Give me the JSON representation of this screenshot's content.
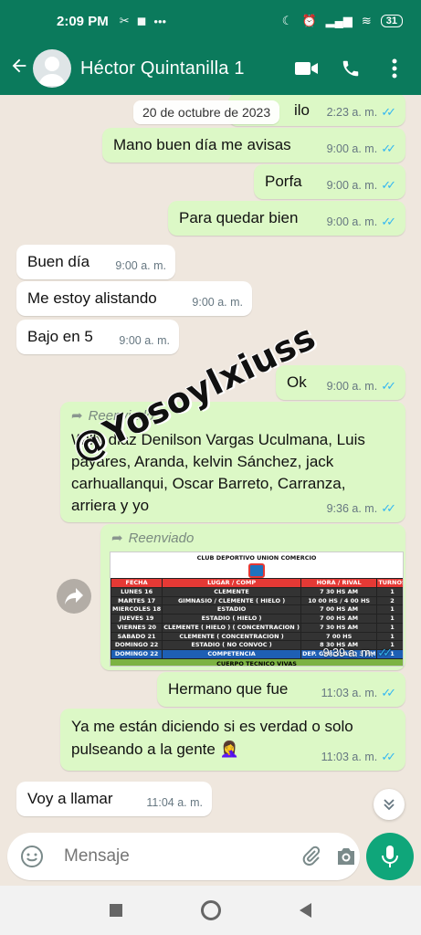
{
  "status_bar": {
    "time": "2:09 PM",
    "battery": "31"
  },
  "header": {
    "contact_name": "Héctor Quintanilla 1"
  },
  "date_chip": "20 de octubre de 2023",
  "messages": [
    {
      "id": "m0",
      "dir": "out",
      "text": "ilo",
      "time": "2:23 a. m."
    },
    {
      "id": "m1",
      "dir": "out",
      "text": "Mano buen día me avisas",
      "time": "9:00 a. m."
    },
    {
      "id": "m2",
      "dir": "out",
      "text": "Porfa",
      "time": "9:00 a. m."
    },
    {
      "id": "m3",
      "dir": "out",
      "text": "Para quedar bien",
      "time": "9:00 a. m."
    },
    {
      "id": "m4",
      "dir": "in",
      "text": "Buen día",
      "time": "9:00 a. m."
    },
    {
      "id": "m5",
      "dir": "in",
      "text": "Me estoy alistando",
      "time": "9:00 a. m."
    },
    {
      "id": "m6",
      "dir": "in",
      "text": "Bajo en 5",
      "time": "9:00 a. m."
    },
    {
      "id": "m7",
      "dir": "out",
      "text": "Ok",
      "time": "9:00 a. m."
    },
    {
      "id": "m8",
      "dir": "out",
      "forwarded": "Reenviado",
      "text": "Willy diaz Denilson Vargas Uculmana, Luis payares, Aranda, kelvin Sánchez, jack carhuallanqui, Oscar Barreto, Carranza, arriera y yo",
      "time": "9:36 a. m."
    },
    {
      "id": "m9",
      "dir": "out",
      "forwarded": "Reenviado",
      "time": "9:39 a. m."
    },
    {
      "id": "m10",
      "dir": "out",
      "text": "Hermano que fue",
      "time": "11:03 a. m."
    },
    {
      "id": "m11",
      "dir": "out",
      "text": "Ya me están diciendo si es verdad o solo pulseando a la gente 🤦‍♀️",
      "time": "11:03 a. m."
    },
    {
      "id": "m12",
      "dir": "in",
      "text": "Voy a llamar",
      "time": "11:04 a. m."
    }
  ],
  "schedule_image": {
    "title": "CLUB DEPORTIVO UNION COMERCIO",
    "headers": [
      "FECHA",
      "LUGAR / COMP",
      "HORA / RIVAL",
      "TURNOS"
    ],
    "rows": [
      [
        "LUNES 16",
        "CLEMENTE",
        "7 30 HS AM",
        "1"
      ],
      [
        "MARTES 17",
        "GIMNASIO / CLEMENTE ( HIELO )",
        "10 00 HS / 4 00 HS",
        "2"
      ],
      [
        "MIERCOLES 18",
        "ESTADIO",
        "7 00 HS AM",
        "1"
      ],
      [
        "JUEVES 19",
        "ESTADIO ( HIELO )",
        "7 00 HS AM",
        "1"
      ],
      [
        "VIERNES 20",
        "CLEMENTE ( HIELO ) ( CONCENTRACION )",
        "7 30 HS AM",
        "1"
      ],
      [
        "SABADO 21",
        "CLEMENTE ( CONCENTRACION )",
        "7 00 HS",
        "1"
      ],
      [
        "DOMINGO 22",
        "ESTADIO ( NO CONVOC )",
        "8 30 HS AM",
        "1"
      ],
      [
        "DOMINGO 22",
        "COMPETENCIA",
        "DEP. GARCILASO 3 PM",
        "1"
      ]
    ],
    "footer": "CUERPO TECNICO VIVAS"
  },
  "watermark": "@Yosoylxiuss",
  "input": {
    "placeholder": "Mensaje"
  },
  "colors": {
    "header": "#0b7a5c",
    "outgoing": "#dcf8c6",
    "incoming": "#ffffff",
    "tick": "#34b7f1"
  }
}
